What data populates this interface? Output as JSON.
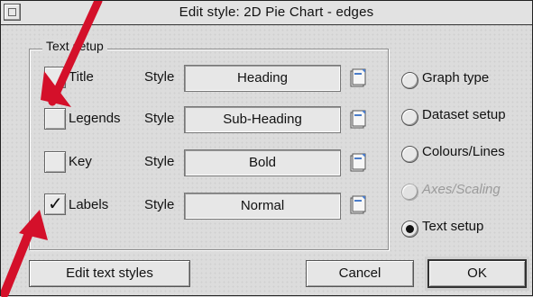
{
  "window": {
    "title": "Edit style: 2D Pie Chart - edges"
  },
  "group": {
    "label": "Text setup"
  },
  "rows": [
    {
      "label": "Title",
      "style_label": "Style",
      "style_value": "Heading",
      "checked": false
    },
    {
      "label": "Legends",
      "style_label": "Style",
      "style_value": "Sub-Heading",
      "checked": false
    },
    {
      "label": "Key",
      "style_label": "Style",
      "style_value": "Bold",
      "checked": false
    },
    {
      "label": "Labels",
      "style_label": "Style",
      "style_value": "Normal",
      "checked": true
    }
  ],
  "radios": [
    {
      "label": "Graph type",
      "selected": false,
      "enabled": true
    },
    {
      "label": "Dataset setup",
      "selected": false,
      "enabled": true
    },
    {
      "label": "Colours/Lines",
      "selected": false,
      "enabled": true
    },
    {
      "label": "Axes/Scaling",
      "selected": false,
      "enabled": false
    },
    {
      "label": "Text setup",
      "selected": true,
      "enabled": true
    }
  ],
  "buttons": {
    "edit_text_styles": "Edit text styles",
    "cancel": "Cancel",
    "ok": "OK"
  },
  "annotation": {
    "arrow_color": "#d4102a",
    "checkmark": "✓"
  }
}
